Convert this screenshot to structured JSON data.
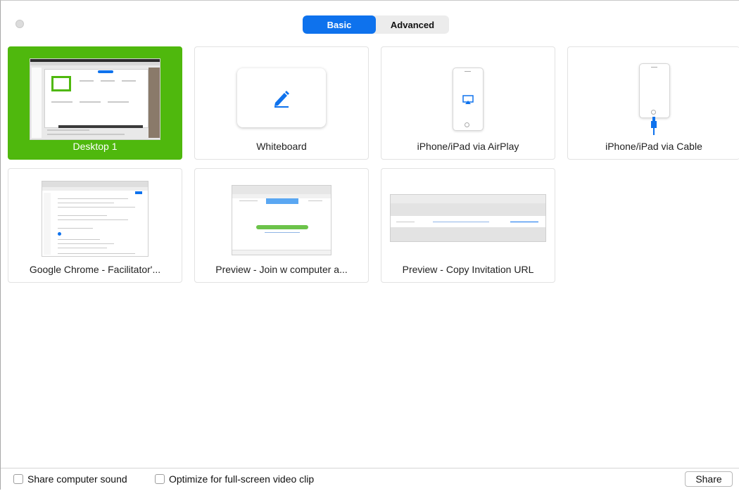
{
  "tabs": {
    "basic": "Basic",
    "advanced": "Advanced",
    "active": "Basic"
  },
  "accent_color": "#0e72ed",
  "selected_color": "#4fb80d",
  "cards": [
    {
      "label": "Desktop 1",
      "selected": true,
      "icon": "desktop-thumbnail"
    },
    {
      "label": "Whiteboard",
      "icon": "pencil-icon"
    },
    {
      "label": "iPhone/iPad via AirPlay",
      "icon": "airplay-icon"
    },
    {
      "label": "iPhone/iPad via Cable",
      "icon": "cable-icon"
    },
    {
      "label": "Google Chrome - Facilitator'...",
      "icon": "chrome-window-thumbnail"
    },
    {
      "label": "Preview - Join w computer a...",
      "icon": "preview-window-thumbnail"
    },
    {
      "label": "Preview - Copy Invitation URL",
      "icon": "preview-window-thumbnail"
    }
  ],
  "options": {
    "share_sound": "Share computer sound",
    "optimize_video": "Optimize for full-screen video clip"
  },
  "share_label": "Share"
}
